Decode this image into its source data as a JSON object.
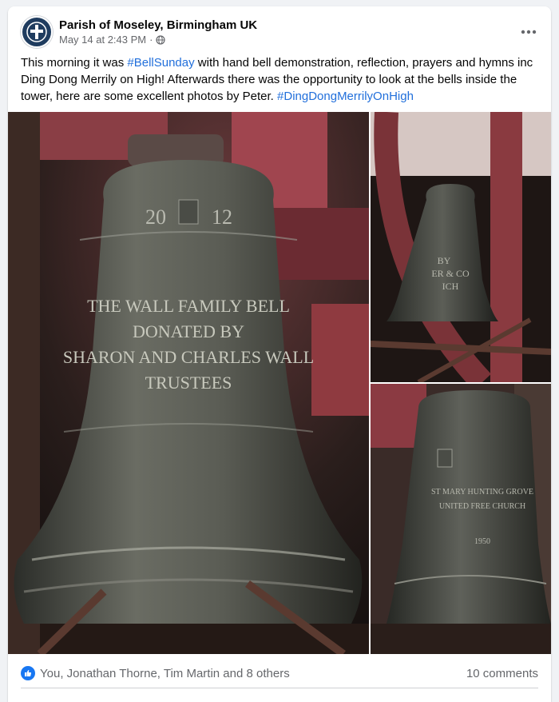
{
  "post": {
    "page_name": "Parish of Moseley, Birmingham UK",
    "timestamp": "May 14 at 2:43 PM",
    "separator": "·",
    "audience_icon": "globe-icon",
    "more_icon": "more-options-icon",
    "text": {
      "part1": "This morning it was ",
      "hashtag1": "#BellSunday",
      "part2": " with hand bell demonstration, reflection, prayers and hymns inc Ding Dong Merrily on High! Afterwards there was the opportunity to look at the bells inside the tower, here are some excellent photos by Peter. ",
      "hashtag2": "#DingDongMerrilyOnHigh"
    },
    "photos": {
      "main": {
        "year_left": "20",
        "year_right": "12",
        "line1": "THE WALL FAMILY BELL",
        "line2": "DONATED BY",
        "line3": "SHARON AND CHARLES WALL",
        "line4": "TRUSTEES"
      },
      "top_right": {
        "line1": "BY",
        "line2": "ER & CO",
        "line3": "ICH"
      },
      "bottom_right": {
        "line1": "ST MARY HUNTING GROVE",
        "line2": "UNITED FREE CHURCH",
        "line3": "1950"
      }
    },
    "reactions": {
      "icon": "like-icon",
      "summary": "You, Jonathan Thorne, Tim Martin and 8 others"
    },
    "comments": "10 comments"
  },
  "colors": {
    "hashtag": "#216fdb",
    "like_blue": "#1877f2",
    "avatar_bg": "#1f3c5f"
  }
}
